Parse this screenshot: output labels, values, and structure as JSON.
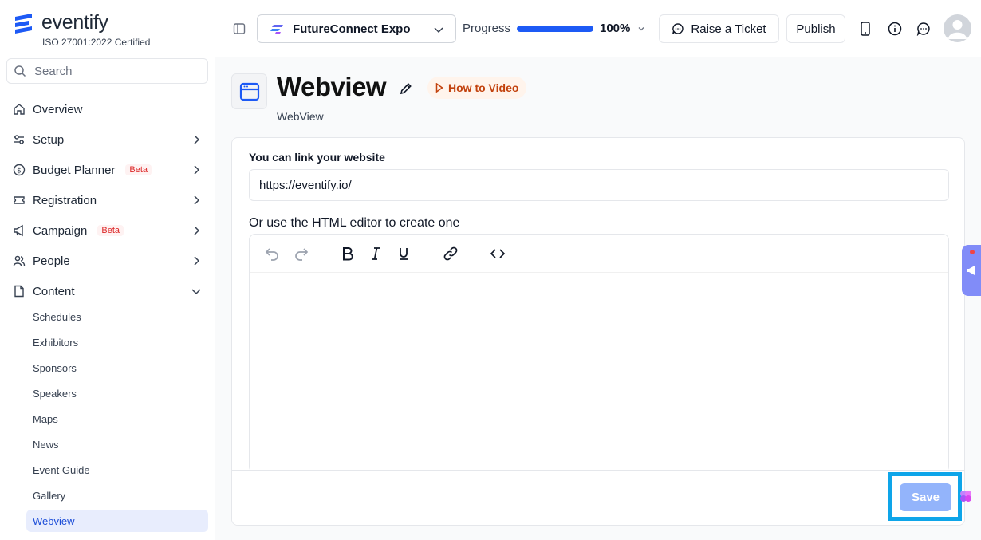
{
  "brand": {
    "name": "eventify",
    "certification": "ISO 27001:2022 Certified"
  },
  "search": {
    "placeholder": "Search"
  },
  "sidebar": {
    "items": [
      {
        "label": "Overview",
        "icon": "home-icon"
      },
      {
        "label": "Setup",
        "icon": "sliders-icon"
      },
      {
        "label": "Budget Planner",
        "icon": "dollar-circle-icon",
        "badge": "Beta"
      },
      {
        "label": "Registration",
        "icon": "ticket-icon"
      },
      {
        "label": "Campaign",
        "icon": "megaphone-icon",
        "badge": "Beta"
      },
      {
        "label": "People",
        "icon": "users-icon"
      },
      {
        "label": "Content",
        "icon": "document-icon"
      }
    ],
    "content_subitems": [
      "Schedules",
      "Exhibitors",
      "Sponsors",
      "Speakers",
      "Maps",
      "News",
      "Event Guide",
      "Gallery",
      "Webview"
    ],
    "active_subitem": "Webview"
  },
  "topbar": {
    "event_name": "FutureConnect Expo",
    "progress_label": "Progress",
    "progress_value": "100%",
    "progress_fraction": 1.0,
    "raise_ticket": "Raise a Ticket",
    "publish": "Publish"
  },
  "page": {
    "title": "Webview",
    "subtitle": "WebView",
    "how_to": "How to Video"
  },
  "form": {
    "website_label": "You can link your website",
    "website_value": "https://eventify.io/",
    "editor_label": "Or use the HTML editor to create one",
    "save": "Save"
  },
  "colors": {
    "accent": "#1d5af5",
    "active_bg": "#e8edfd",
    "beta": "#dc2626",
    "save_disabled": "#93b4fb",
    "highlight": "#0ea5e9"
  }
}
